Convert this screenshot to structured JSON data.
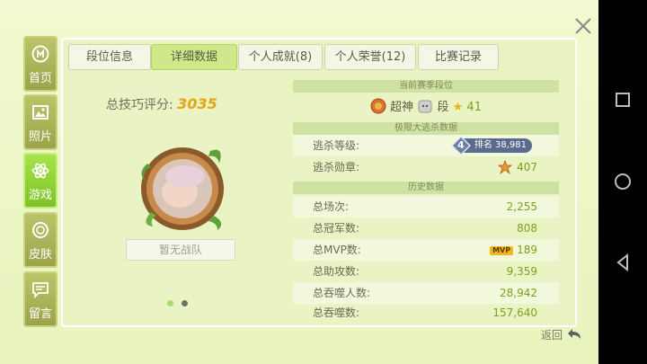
{
  "sidebar": [
    {
      "label": "首页",
      "icon": "home-icon",
      "active": false
    },
    {
      "label": "照片",
      "icon": "photo-icon",
      "active": false
    },
    {
      "label": "游戏",
      "icon": "atom-icon",
      "active": true
    },
    {
      "label": "皮肤",
      "icon": "skin-icon",
      "active": false
    },
    {
      "label": "留言",
      "icon": "message-icon",
      "active": false
    }
  ],
  "tabs": [
    "段位信息",
    "详细数据",
    "个人成就(8)",
    "个人荣誉(12)",
    "比赛记录"
  ],
  "active_tab": 1,
  "skill": {
    "label": "总技巧评分:",
    "value": "3035"
  },
  "team_button": "暂无战队",
  "season": {
    "header": "当前赛季段位",
    "rank_prefix": "超神",
    "rank_suffix": "段",
    "stars": "41"
  },
  "escape": {
    "header": "极限大逃杀数据",
    "level_label": "逃杀等级:",
    "level_badge_num": "4",
    "level_badge_text": "排名 38,981",
    "medal_label": "逃杀勋章:",
    "medal_value": "407"
  },
  "history": {
    "header": "历史数据",
    "rows": [
      {
        "k": "总场次:",
        "v": "2,255"
      },
      {
        "k": "总冠军数:",
        "v": "808"
      },
      {
        "k": "总MVP数:",
        "v": "189",
        "mvp_tag": "MVP"
      },
      {
        "k": "总助攻数:",
        "v": "9,359"
      },
      {
        "k": "总吞噬人数:",
        "v": "28,942"
      },
      {
        "k": "总吞噬数:",
        "v": "157,640"
      }
    ]
  },
  "back_label": "返回",
  "colors": {
    "active_green": "#8fd13a",
    "value_green": "#7aa21a",
    "score_gold": "#e3a619"
  }
}
